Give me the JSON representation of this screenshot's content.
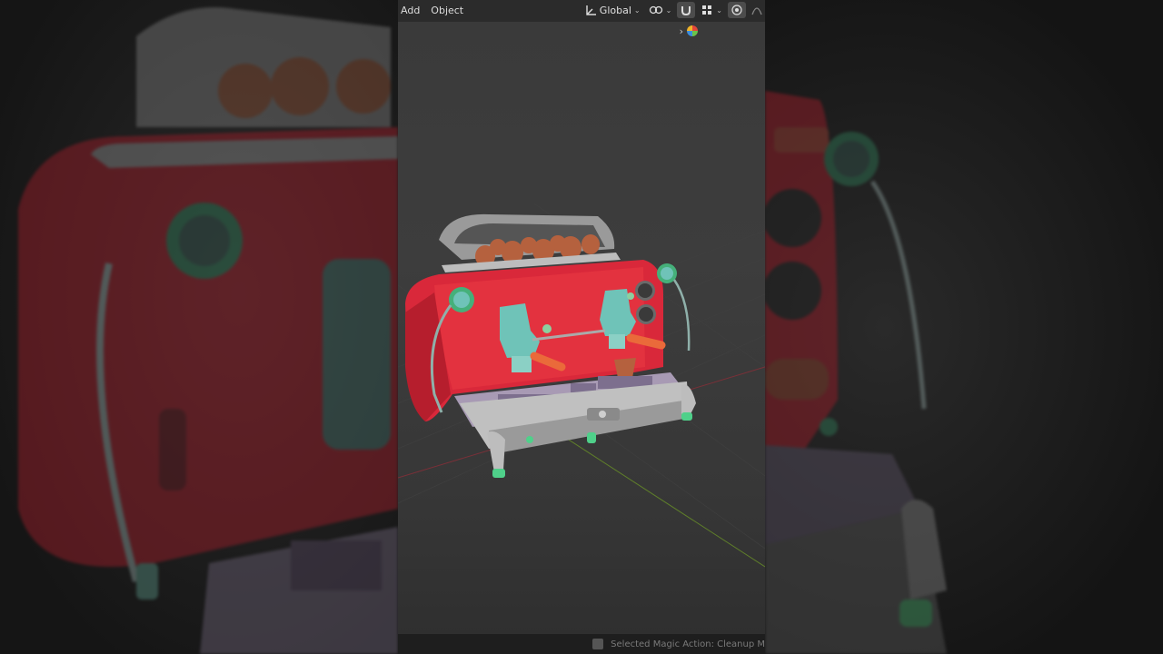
{
  "header": {
    "menu": [
      "Add",
      "Object"
    ],
    "orientation_label": "Global",
    "icons": [
      "transform-orientation-icon",
      "pivot-link-icon",
      "snap-magnet-icon",
      "snap-grid-icon",
      "proportional-edit-icon",
      "falloff-icon"
    ]
  },
  "gizmo": {
    "icon": "navigation-gizmo-icon"
  },
  "status": {
    "text": "Selected Magic Action: Cleanup M"
  },
  "colors": {
    "header_bg": "#2b2b2b",
    "viewport_bg": "#3a3a3a",
    "machine_red": "#d9283a",
    "accent_teal": "#6fc3b8",
    "accent_green": "#45b07a",
    "cup_brown": "#b5613e",
    "tray_purple": "#8a7a9a",
    "axis_red": "#8a2f36",
    "axis_green": "#6a8a2a"
  }
}
